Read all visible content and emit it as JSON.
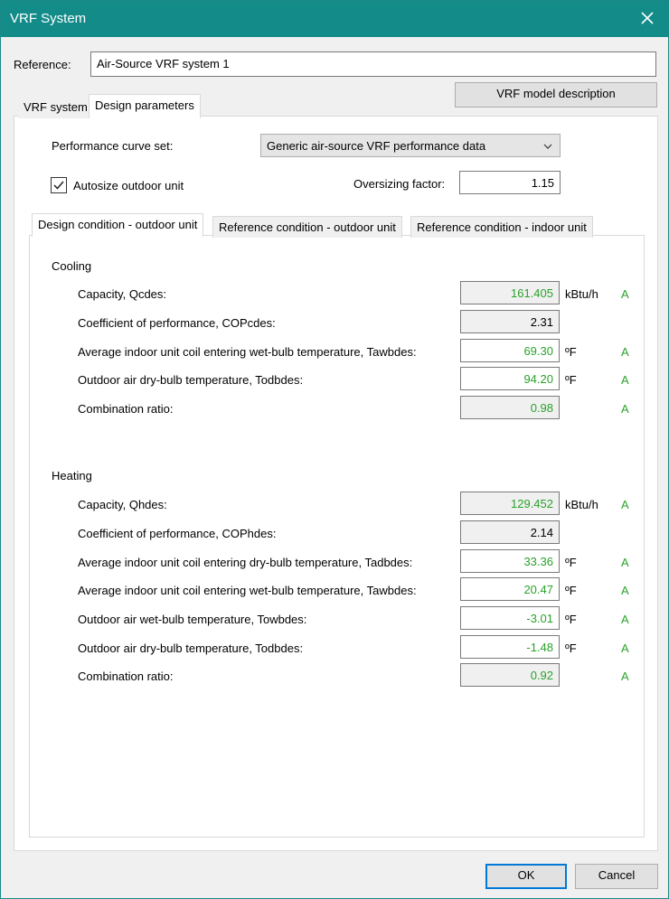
{
  "window": {
    "title": "VRF System"
  },
  "reference": {
    "label": "Reference:",
    "value": "Air-Source VRF system 1"
  },
  "model_description_button": "VRF model description",
  "main_tabs": [
    {
      "label": "VRF system",
      "active": false
    },
    {
      "label": "Design parameters",
      "active": true
    }
  ],
  "performance_curve": {
    "label": "Performance curve set:",
    "selected": "Generic air-source VRF performance data"
  },
  "autosize": {
    "label": "Autosize outdoor unit",
    "checked": true
  },
  "oversizing": {
    "label": "Oversizing factor:",
    "value": "1.15"
  },
  "sub_tabs": [
    {
      "label": "Design condition - outdoor unit",
      "active": true
    },
    {
      "label": "Reference condition - outdoor unit",
      "active": false
    },
    {
      "label": "Reference condition - indoor unit",
      "active": false
    }
  ],
  "cooling": {
    "heading": "Cooling",
    "rows": [
      {
        "label": "Capacity, Qcdes:",
        "value": "161.405",
        "unit": "kBtu/h",
        "flag": "A",
        "editable": false,
        "green": true
      },
      {
        "label": "Coefficient of performance, COPcdes:",
        "value": "2.31",
        "unit": "",
        "flag": "",
        "editable": false,
        "green": false
      },
      {
        "label": "Average indoor unit coil entering wet-bulb temperature, Tawbdes:",
        "value": "69.30",
        "unit": "ºF",
        "flag": "A",
        "editable": true,
        "green": true
      },
      {
        "label": "Outdoor air dry-bulb temperature, Todbdes:",
        "value": "94.20",
        "unit": "ºF",
        "flag": "A",
        "editable": true,
        "green": true
      },
      {
        "label": "Combination ratio:",
        "value": "0.98",
        "unit": "",
        "flag": "A",
        "editable": false,
        "green": true
      }
    ]
  },
  "heating": {
    "heading": "Heating",
    "rows": [
      {
        "label": "Capacity, Qhdes:",
        "value": "129.452",
        "unit": "kBtu/h",
        "flag": "A",
        "editable": false,
        "green": true
      },
      {
        "label": "Coefficient of performance, COPhdes:",
        "value": "2.14",
        "unit": "",
        "flag": "",
        "editable": false,
        "green": false
      },
      {
        "label": "Average indoor unit coil entering dry-bulb temperature, Tadbdes:",
        "value": "33.36",
        "unit": "ºF",
        "flag": "A",
        "editable": true,
        "green": true
      },
      {
        "label": "Average indoor unit coil entering wet-bulb temperature, Tawbdes:",
        "value": "20.47",
        "unit": "ºF",
        "flag": "A",
        "editable": true,
        "green": true
      },
      {
        "label": "Outdoor air wet-bulb temperature, Towbdes:",
        "value": "-3.01",
        "unit": "ºF",
        "flag": "A",
        "editable": true,
        "green": true
      },
      {
        "label": "Outdoor air dry-bulb temperature, Todbdes:",
        "value": "-1.48",
        "unit": "ºF",
        "flag": "A",
        "editable": true,
        "green": true
      },
      {
        "label": "Combination ratio:",
        "value": "0.92",
        "unit": "",
        "flag": "A",
        "editable": false,
        "green": true
      }
    ]
  },
  "ok_button": "OK",
  "cancel_button": "Cancel"
}
